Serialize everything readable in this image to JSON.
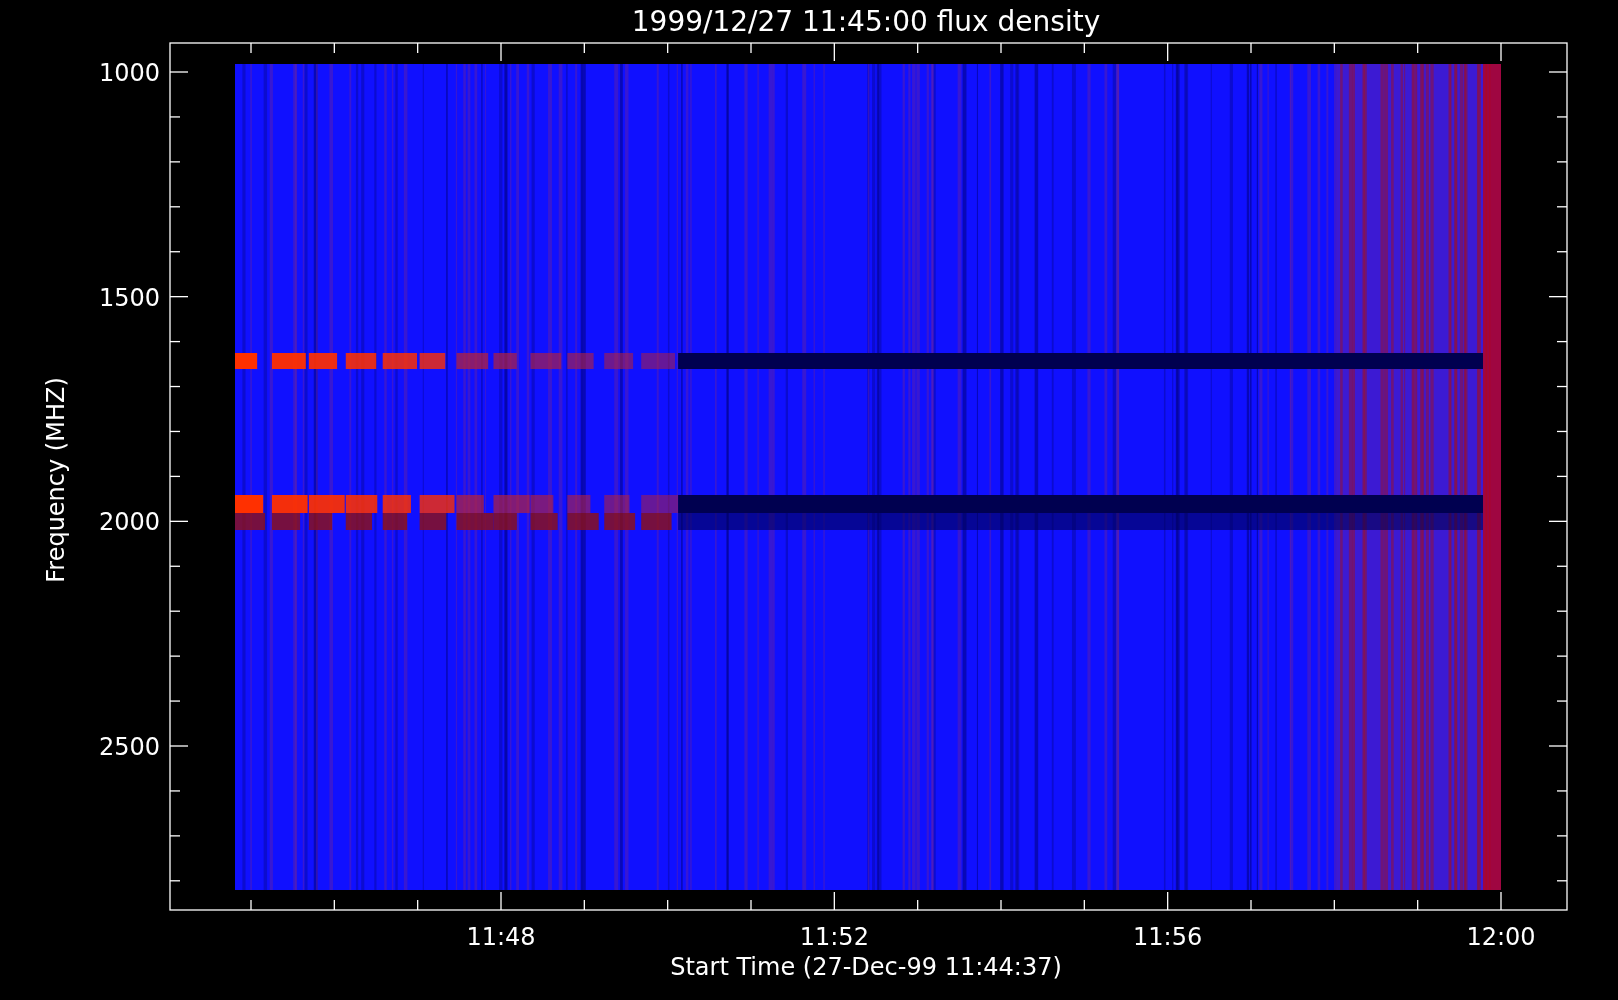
{
  "title": "1999/12/27 11:45:00 flux density",
  "y_axis": {
    "label": "Frequency (MHZ)",
    "ticks": [
      "1000",
      "1500",
      "2000",
      "2500"
    ]
  },
  "x_axis": {
    "label": "Start Time (27-Dec-99 11:44:37)",
    "ticks": [
      "11:48",
      "11:52",
      "11:56",
      "12:00"
    ]
  }
}
